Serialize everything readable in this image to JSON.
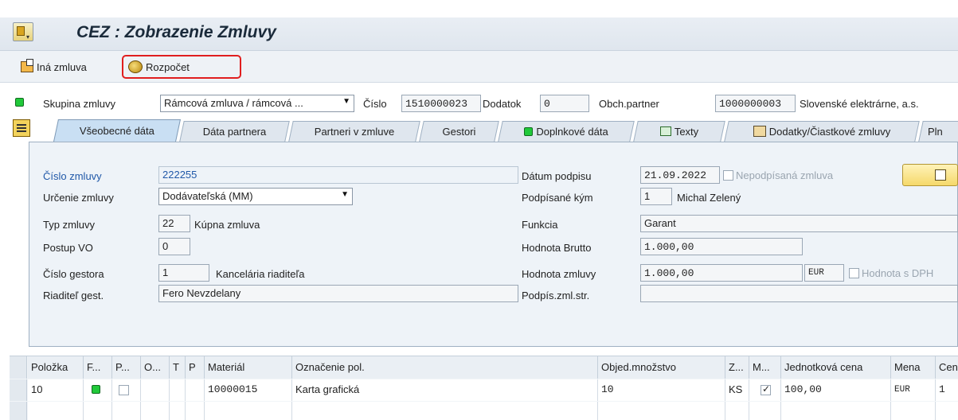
{
  "window": {
    "title": "CEZ : Zobrazenie Zmluvy"
  },
  "toolbar": {
    "other_contract_label": "Iná zmluva",
    "budget_label": "Rozpočet"
  },
  "header": {
    "group_label": "Skupina zmluvy",
    "group_value": "Rámcová zmluva / rámcová ...",
    "number_label": "Číslo",
    "number_value": "1510000023",
    "addendum_label": "Dodatok",
    "addendum_value": "0",
    "partner_label": "Obch.partner",
    "partner_id": "1000000003",
    "partner_name": "Slovenské elektrárne, a.s."
  },
  "tabs": [
    {
      "label": "Všeobecné dáta",
      "active": true
    },
    {
      "label": "Dáta partnera"
    },
    {
      "label": "Partneri v zmluve"
    },
    {
      "label": "Gestori"
    },
    {
      "label": "Doplnkové dáta"
    },
    {
      "label": "Texty"
    },
    {
      "label": "Dodatky/Čiastkové zmluvy"
    },
    {
      "label": "Pln"
    }
  ],
  "form": {
    "contract_no_label": "Číslo zmluvy",
    "contract_no_value": "222255",
    "purpose_label": "Určenie zmluvy",
    "purpose_value": "Dodávateľská (MM)",
    "type_label": "Typ zmluvy",
    "type_code": "22",
    "type_text": "Kúpna zmluva",
    "procedure_label": "Postup VO",
    "procedure_value": "0",
    "guarantor_no_label": "Číslo gestora",
    "guarantor_no_value": "1",
    "guarantor_name": "Kancelária riaditeľa",
    "director_label": "Riaditeľ gest.",
    "director_value": "Fero Nevzdelany",
    "sign_date_label": "Dátum podpisu",
    "sign_date_value": "21.09.2022",
    "unsigned_label": "Nepodpísaná zmluva",
    "signed_by_label": "Podpísané kým",
    "signed_by_code": "1",
    "signed_by_name": "Michal Zelený",
    "function_label": "Funkcia",
    "function_value": "Garant",
    "gross_label": "Hodnota Brutto",
    "gross_value": "1.000,00",
    "value_label": "Hodnota zmluvy",
    "value_value": "1.000,00",
    "currency_value": "EUR",
    "vat_label": "Hodnota s DPH",
    "signatory_label": "Podpís.zml.str.",
    "signatory_value": ""
  },
  "table": {
    "headers": [
      "Položka",
      "F...",
      "P...",
      "O...",
      "T",
      "P",
      "Materiál",
      "Označenie pol.",
      "Objed.množstvo",
      "Z...",
      "M...",
      "Jednotková cena",
      "Mena",
      "Cen"
    ],
    "rows": [
      {
        "item": "10",
        "material": "10000015",
        "description": "Karta grafická",
        "quantity": "10",
        "unit": "KS",
        "price": "100,00",
        "currency": "EUR",
        "cen": "1",
        "m_checked": true
      }
    ]
  },
  "colors": {
    "accent_red": "#e01e1e",
    "led_green": "#21c93a",
    "link_blue": "#2058a8"
  }
}
